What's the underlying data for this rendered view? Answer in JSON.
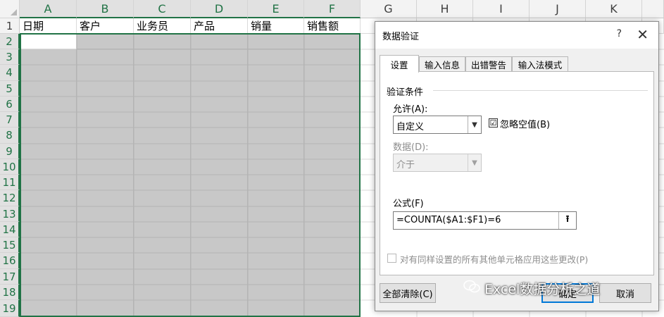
{
  "sheet": {
    "columns": [
      "A",
      "B",
      "C",
      "D",
      "E",
      "F",
      "G",
      "H",
      "I",
      "J",
      "K"
    ],
    "rows": [
      "1",
      "2",
      "3",
      "4",
      "5",
      "6",
      "7",
      "8",
      "9",
      "10",
      "11",
      "12",
      "13",
      "14",
      "15",
      "16",
      "17",
      "18",
      "19"
    ],
    "headers": [
      "日期",
      "客户",
      "业务员",
      "产品",
      "销量",
      "销售额"
    ],
    "accent_color": "#217346",
    "selected_fill": "#c8c8c8"
  },
  "dialog": {
    "title": "数据验证",
    "help": "?",
    "close": "✕",
    "tabs": [
      "设置",
      "输入信息",
      "出错警告",
      "输入法模式"
    ],
    "active_tab": "设置",
    "group_label": "验证条件",
    "allow_label": "允许(A):",
    "allow_value": "自定义",
    "ignore_blank_label": "忽略空值(B)",
    "ignore_blank_checked": "☑",
    "data_label": "数据(D):",
    "data_value": "介于",
    "formula_label": "公式(F)",
    "formula_value": "=COUNTA($A1:$F1)=6",
    "apply_all_label": "对有同样设置的所有其他单元格应用这些更改(P)",
    "clear_all_label": "全部清除(C)",
    "ok_label": "确定",
    "cancel_label": "取消"
  },
  "watermark": {
    "text": "Excel数据分析之道",
    "icon": "wechat-icon"
  }
}
